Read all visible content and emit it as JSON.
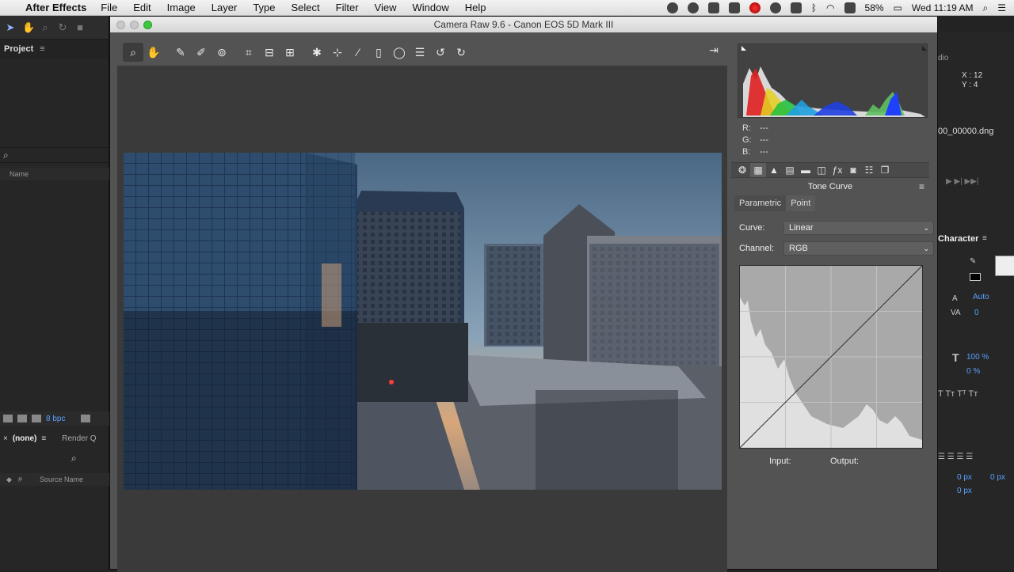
{
  "menubar": {
    "app_name": "After Effects",
    "menus": [
      "File",
      "Edit",
      "Image",
      "Layer",
      "Type",
      "Select",
      "Filter",
      "View",
      "Window",
      "Help"
    ],
    "battery": "58%",
    "clock": "Wed 11:19 AM"
  },
  "ae": {
    "project_title": "Project",
    "name_col": "Name",
    "bpc": "8 bpc",
    "timeline_comp": "(none)",
    "render_tab": "Render Q",
    "source_name_col": "Source Name",
    "hash_col": "#",
    "right": {
      "info_header": "dio",
      "xy_x": "X : 12",
      "xy_y": "Y : 4",
      "filename": "00_00000.dng",
      "character_title": "Character",
      "auto": "Auto",
      "zero": "0",
      "scale_v": "100 %",
      "baseline": "0 %",
      "px1": "0 px",
      "px2": "0 px",
      "px3": "0 px"
    }
  },
  "cameraraw": {
    "window_title": "Camera Raw 9.6  -  Canon EOS 5D Mark III",
    "readout": {
      "r_label": "R:",
      "r": "---",
      "g_label": "G:",
      "g": "---",
      "b_label": "B:",
      "b": "---"
    },
    "panel_name": "Tone Curve",
    "subtabs": [
      "Parametric",
      "Point"
    ],
    "curve_label": "Curve:",
    "curve_value": "Linear",
    "channel_label": "Channel:",
    "channel_value": "RGB",
    "input_label": "Input:",
    "output_label": "Output:"
  },
  "icons": [
    "zoom-tool",
    "hand-tool",
    "white-balance",
    "color-sampler",
    "targeted-adjustment",
    "crop",
    "straighten",
    "transform",
    "spot-removal",
    "red-eye",
    "adjustment-brush",
    "graduated-filter",
    "radial-filter",
    "presets",
    "rotate-ccw",
    "rotate-cw"
  ]
}
